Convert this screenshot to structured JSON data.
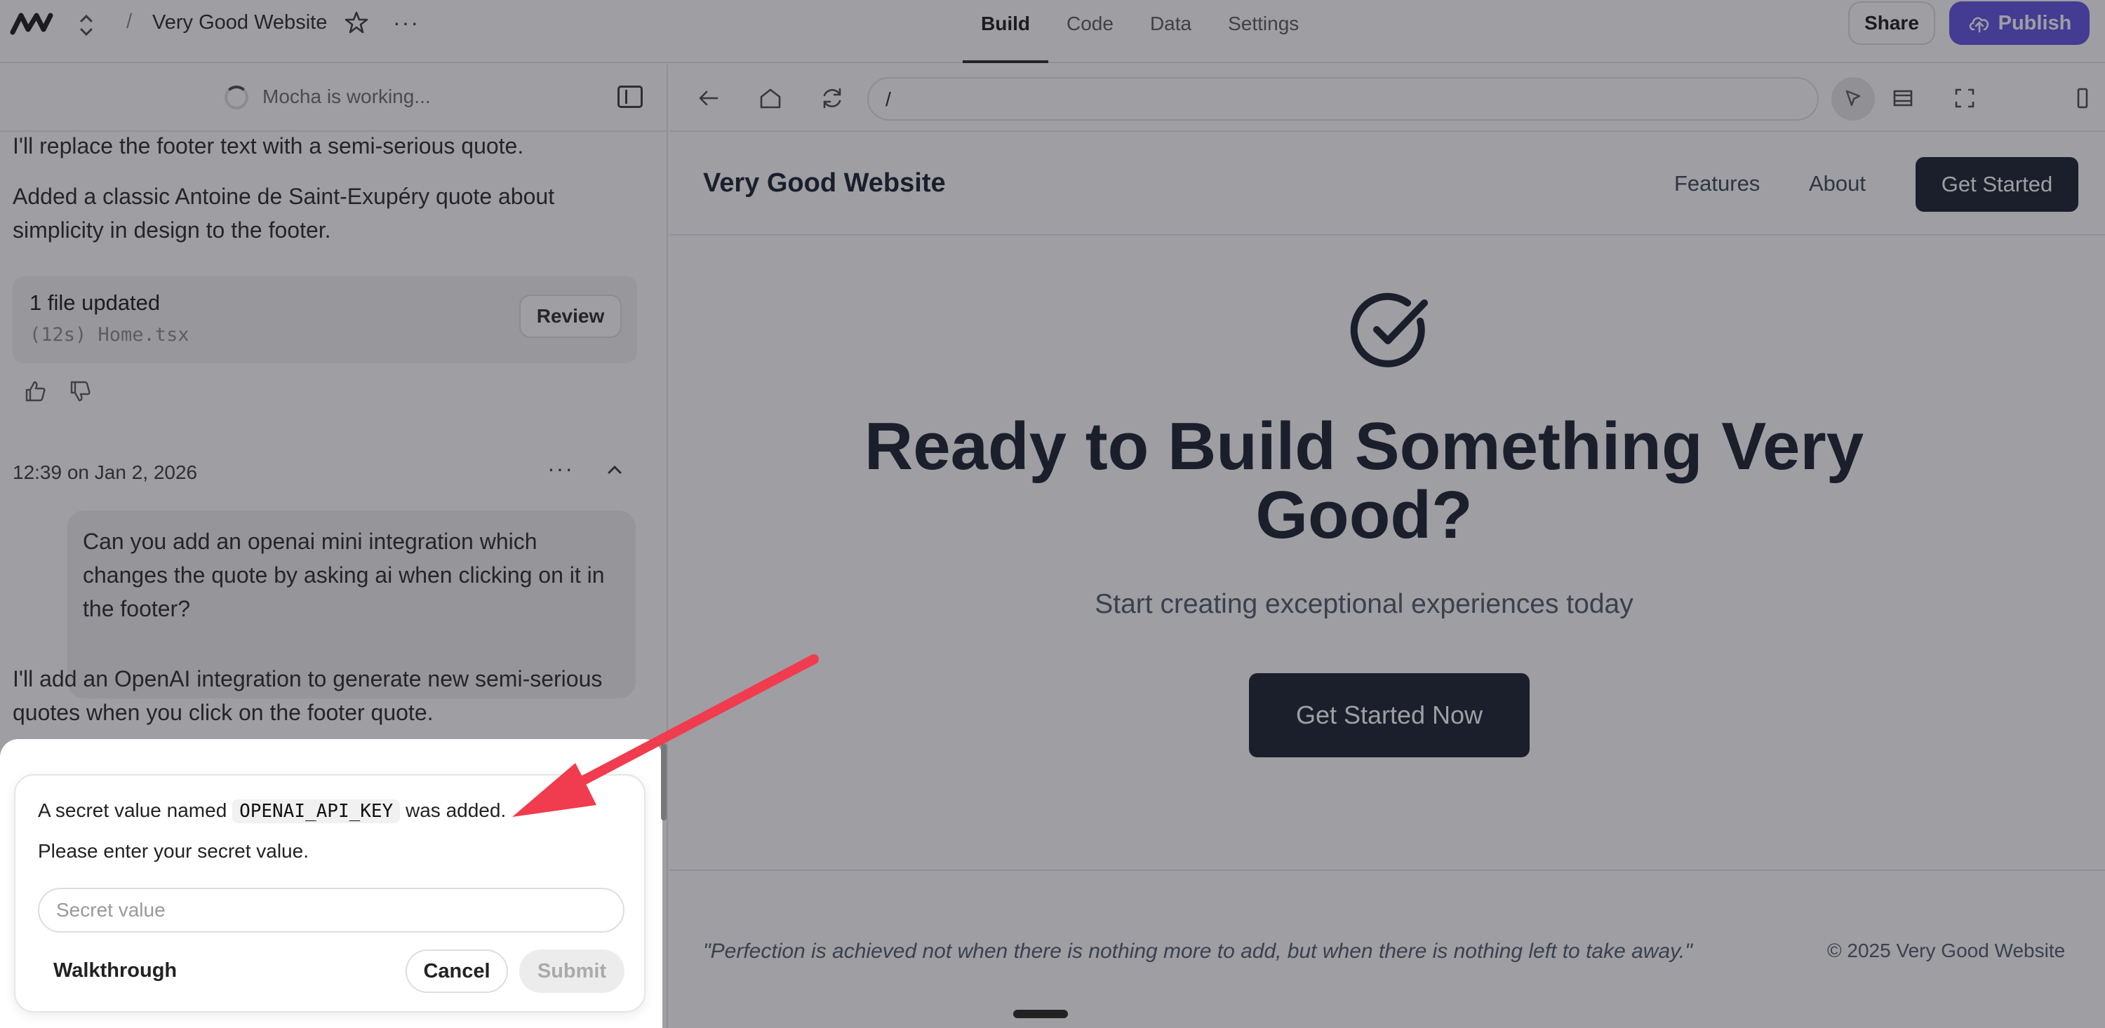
{
  "topbar": {
    "project_name": "Very Good Website",
    "tabs": [
      {
        "label": "Build"
      },
      {
        "label": "Code"
      },
      {
        "label": "Data"
      },
      {
        "label": "Settings"
      }
    ],
    "share_label": "Share",
    "publish_label": "Publish",
    "slash": "/",
    "more": "···"
  },
  "chat": {
    "status": "Mocha is working...",
    "msg1": "I'll replace the footer text with a semi-serious quote.",
    "msg2": "Added a classic Antoine de Saint-Exupéry quote about simplicity in design to the footer.",
    "file_card": {
      "title": "1 file updated",
      "detail": "(12s) Home.tsx",
      "review_label": "Review"
    },
    "timestamp": "12:39 on Jan 2, 2026",
    "more": "···",
    "user_message": "Can you add an openai mini integration which changes the quote by asking ai when clicking on it in the footer?",
    "msg3": "I'll add an OpenAI integration to generate new semi-serious quotes when you click on the footer quote."
  },
  "secret_modal": {
    "line1_prefix": "A secret value named",
    "secret_name": "OPENAI_API_KEY",
    "line1_suffix": "was added.",
    "line2": "Please enter your secret value.",
    "input_placeholder": "Secret value",
    "walkthrough_label": "Walkthrough",
    "cancel_label": "Cancel",
    "submit_label": "Submit"
  },
  "browser": {
    "url": "/"
  },
  "site": {
    "brand": "Very Good Website",
    "nav": [
      {
        "label": "Features"
      },
      {
        "label": "About"
      }
    ],
    "header_cta": "Get Started",
    "hero_title": "Ready to Build Something Very Good?",
    "hero_subtitle": "Start creating exceptional experiences today",
    "hero_cta": "Get Started Now",
    "footer_quote": "\"Perfection is achieved not when there is nothing more to add, but when there is nothing left to take away.\"",
    "copyright": "© 2025 Very Good Website"
  },
  "colors": {
    "publish": "#5b4ce0",
    "site_dark": "#111827",
    "arrow": "#f03c4e"
  }
}
